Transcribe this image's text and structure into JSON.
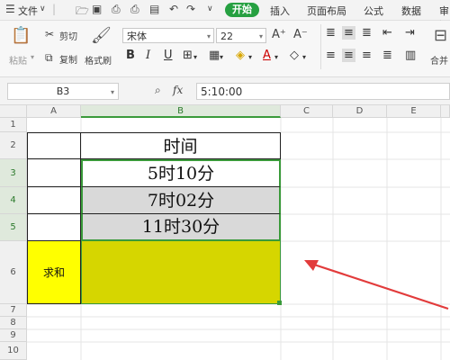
{
  "menubar": {
    "file": "文件",
    "start": "开始",
    "insert": "插入",
    "layout": "页面布局",
    "formula": "公式",
    "data": "数据",
    "review": "审阅"
  },
  "ribbon": {
    "paste": "粘贴",
    "cut": "剪切",
    "copy": "复制",
    "format_painter": "格式刷",
    "font_name": "宋体",
    "font_size": "22",
    "merge_center": "合并"
  },
  "formula_bar": {
    "cell_ref": "B3",
    "fx": "fx",
    "value": "5:10:00"
  },
  "sheet": {
    "columns": [
      "A",
      "B",
      "C",
      "D",
      "E"
    ],
    "rows": [
      "1",
      "2",
      "3",
      "4",
      "5",
      "6",
      "7",
      "8",
      "9",
      "10"
    ],
    "b2": "时间",
    "b3": "5时10分",
    "b4": "7时02分",
    "b5": "11时30分",
    "a6": "求和",
    "b6": ""
  },
  "colors": {
    "accent_green": "#26a041",
    "yellow_fill": "#d6d600",
    "gray_fill": "#d9d9d9",
    "arrow_red": "#e23b3b"
  }
}
